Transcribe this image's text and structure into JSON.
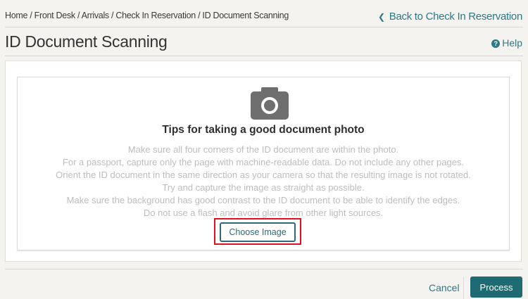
{
  "breadcrumb": "Home / Front Desk / Arrivals / Check In Reservation / ID Document Scanning",
  "back_link": "Back to Check In Reservation",
  "page_title": "ID Document Scanning",
  "help_label": "Help",
  "tips_title": "Tips for taking a good document photo",
  "tips": [
    "Make sure all four corners of the ID document are within the photo.",
    "For a passport, capture only the page with machine-readable data. Do not include any other pages.",
    "Orient the ID document in the same direction as your camera so that the resulting image is not rotated.",
    "Try and capture the image as straight as possible.",
    "Make sure the background has good contrast to the ID document to be able to identify the edges.",
    "Do not use a flash and avoid glare from other light sources."
  ],
  "choose_image_label": "Choose Image",
  "cancel_label": "Cancel",
  "process_label": "Process",
  "colors": {
    "accent": "#2b7a86",
    "primary_button": "#1f6b73",
    "highlight": "#e01020"
  }
}
